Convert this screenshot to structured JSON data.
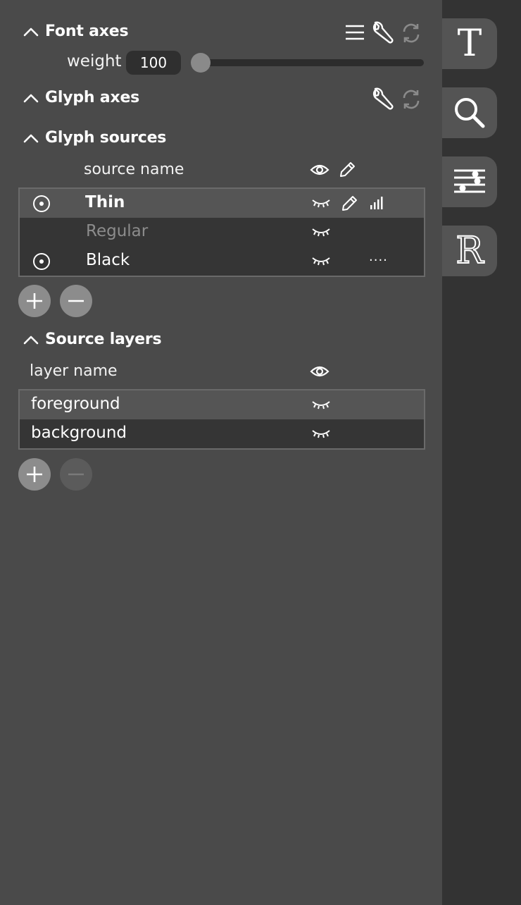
{
  "font_axes": {
    "title": "Font axes",
    "axis": {
      "name": "weight",
      "value": "100",
      "slider_fraction": 0.0
    }
  },
  "glyph_axes": {
    "title": "Glyph axes"
  },
  "glyph_sources": {
    "title": "Glyph sources",
    "column_header": "source name",
    "rows": [
      {
        "name": "Thin",
        "selected": true,
        "bold": true,
        "muted": false,
        "radio": true,
        "pencil": true,
        "status": "signal"
      },
      {
        "name": "Regular",
        "selected": false,
        "bold": false,
        "muted": true,
        "radio": false,
        "pencil": false,
        "status": ""
      },
      {
        "name": "Black",
        "selected": false,
        "bold": false,
        "muted": false,
        "radio": true,
        "pencil": false,
        "status": "...."
      }
    ]
  },
  "source_layers": {
    "title": "Source layers",
    "column_header": "layer name",
    "rows": [
      {
        "name": "foreground",
        "selected": true
      },
      {
        "name": "background",
        "selected": false
      }
    ]
  },
  "sidebar": {
    "tabs": [
      {
        "icon": "text-T-icon",
        "label": "T"
      },
      {
        "icon": "search-icon"
      },
      {
        "icon": "sliders-icon"
      },
      {
        "icon": "reference-R-icon",
        "label": "R"
      }
    ]
  }
}
